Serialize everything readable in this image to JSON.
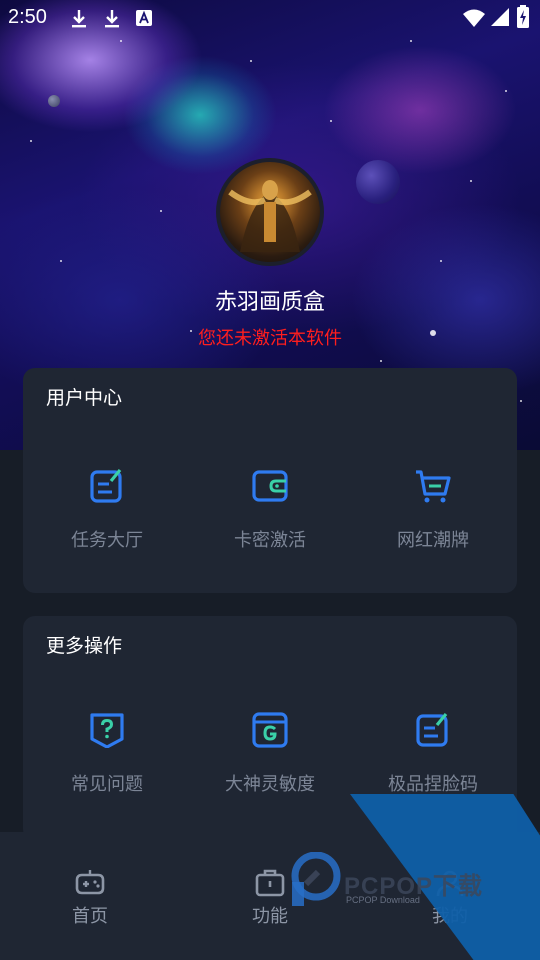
{
  "status_bar": {
    "time": "2:50",
    "left_icons": [
      "download-icon",
      "download-icon",
      "font-a-icon"
    ],
    "right_icons": [
      "wifi-icon",
      "cell-signal-icon",
      "battery-charging-icon"
    ]
  },
  "profile": {
    "app_name": "赤羽画质盒",
    "activation_status": "您还未激活本软件",
    "status_color": "#ff1e1e"
  },
  "user_center": {
    "title": "用户中心",
    "items": [
      {
        "label": "任务大厅",
        "icon": "edit-note-icon"
      },
      {
        "label": "卡密激活",
        "icon": "wallet-icon"
      },
      {
        "label": "网红潮牌",
        "icon": "shopping-cart-icon"
      }
    ]
  },
  "more_actions": {
    "title": "更多操作",
    "items": [
      {
        "label": "常见问题",
        "icon": "help-shield-icon"
      },
      {
        "label": "大神灵敏度",
        "icon": "g-window-icon"
      },
      {
        "label": "极品捏脸码",
        "icon": "edit-note-icon"
      }
    ]
  },
  "bottom_nav": {
    "items": [
      {
        "label": "首页",
        "icon": "gamepad-icon"
      },
      {
        "label": "功能",
        "icon": "toolbox-icon"
      },
      {
        "label": "我的",
        "icon": "user-icon"
      }
    ]
  },
  "watermark": {
    "text": "PCPOP下载",
    "subtext": "PCPOP Download"
  },
  "colors": {
    "background": "#171d27",
    "card": "#1f2633",
    "icon_blue": "#2f7bf0",
    "icon_accent": "#3ad0a8",
    "label_gray": "#7c8596",
    "watermark_blue": "#0f5fa8"
  }
}
